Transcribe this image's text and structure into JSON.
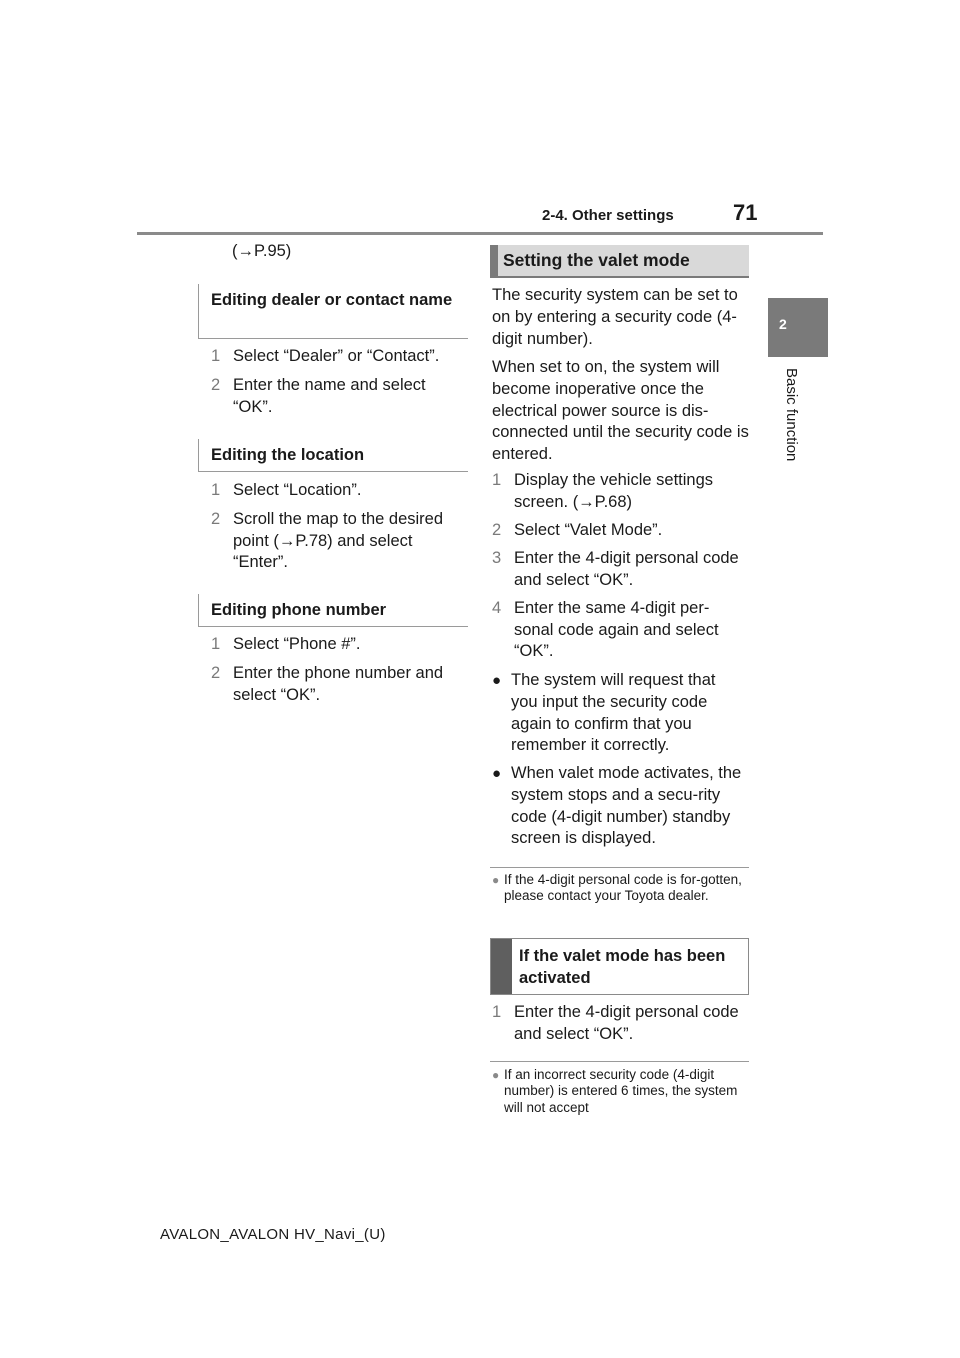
{
  "header": {
    "section_title": "2-4. Other settings",
    "page_number": "71"
  },
  "side_tab": {
    "chapter_number": "2",
    "chapter_label": "Basic function"
  },
  "left_column": {
    "reference": "(→P.95)",
    "sections": [
      {
        "heading": "Editing dealer or contact name",
        "steps": [
          {
            "num": "1",
            "text": "Select “Dealer” or “Contact”."
          },
          {
            "num": "2",
            "text": "Enter the name and select “OK”."
          }
        ]
      },
      {
        "heading": "Editing the location",
        "steps": [
          {
            "num": "1",
            "text": "Select “Location”."
          },
          {
            "num": "2",
            "text": "Scroll the map to the desired point (→P.78) and select “Enter”."
          }
        ]
      },
      {
        "heading": "Editing phone number",
        "steps": [
          {
            "num": "1",
            "text": "Select “Phone #”."
          },
          {
            "num": "2",
            "text": "Enter the phone number and select “OK”."
          }
        ]
      }
    ]
  },
  "right_column": {
    "section_heading": "Setting the valet mode",
    "intro_paragraphs": [
      "The security system can be set to on by entering a security code (4-digit number).",
      "When set to on, the system will become inoperative once the electrical power source is dis-connected until the security code is entered."
    ],
    "steps": [
      {
        "num": "1",
        "text": "Display the vehicle settings screen. (→P.68)"
      },
      {
        "num": "2",
        "text": "Select “Valet Mode”."
      },
      {
        "num": "3",
        "text": "Enter the 4-digit personal code and select “OK”."
      },
      {
        "num": "4",
        "text": "Enter the same 4-digit per-sonal code again and select “OK”."
      }
    ],
    "bullets": [
      "The system will request that you input the security code again to confirm that you remember it correctly.",
      "When valet mode activates, the system stops and a secu-rity code (4-digit number) standby screen is displayed."
    ],
    "note_1": "If the 4-digit personal code is for-gotten, please contact your Toyota dealer.",
    "subsection_heading": "If the valet mode has been activated",
    "sub_steps": [
      {
        "num": "1",
        "text": "Enter the 4-digit personal code and select “OK”."
      }
    ],
    "note_2": "If an incorrect security code (4-digit number) is entered 6 times, the system will not accept"
  },
  "footer": {
    "doc_id": "AVALON_AVALON HV_Navi_(U)"
  }
}
